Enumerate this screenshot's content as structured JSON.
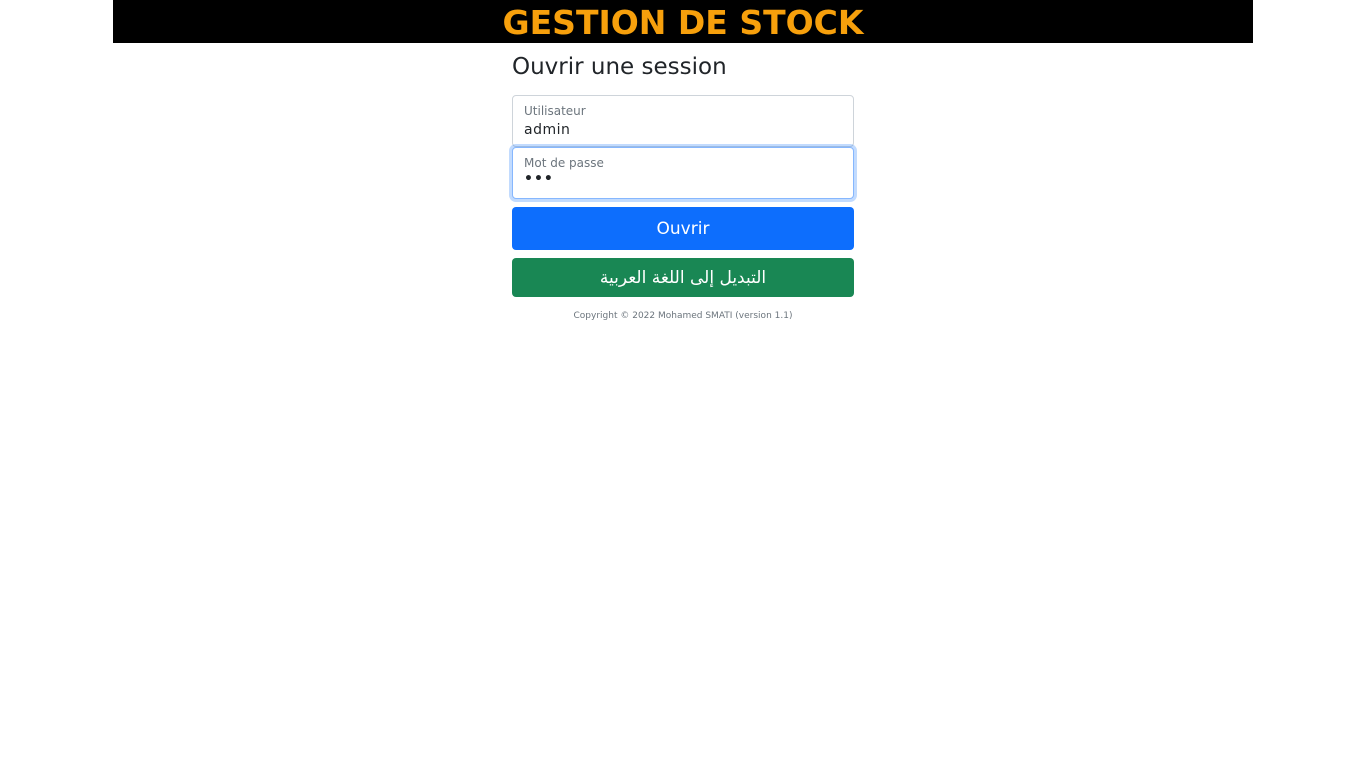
{
  "header": {
    "title": "GESTION DE STOCK"
  },
  "login": {
    "title": "Ouvrir une session",
    "username": {
      "label": "Utilisateur",
      "value": "admin"
    },
    "password": {
      "label": "Mot de passe",
      "value": "•••"
    },
    "submit_label": "Ouvrir",
    "switch_language_label": "التبديل إلى اللغة العربية"
  },
  "footer": {
    "copyright": "Copyright © 2022 Mohamed SMATI (version 1.1)"
  },
  "colors": {
    "header_bg": "#000000",
    "header_text": "#f7a00c",
    "primary": "#0d6efd",
    "success": "#198754"
  }
}
